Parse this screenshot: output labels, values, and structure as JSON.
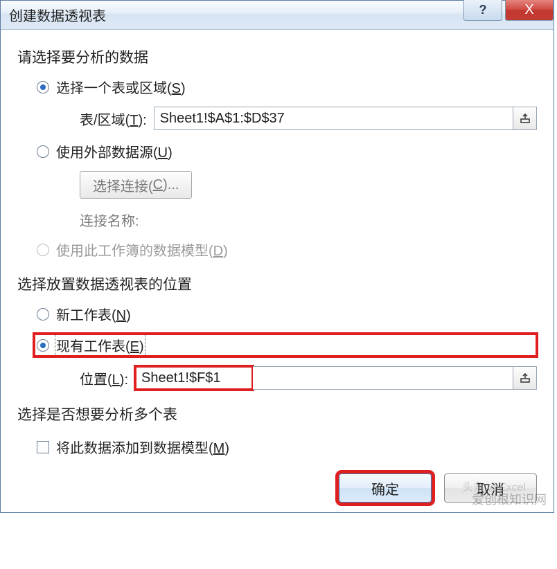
{
  "titlebar": {
    "title": "创建数据透视表",
    "help_symbol": "?",
    "close_symbol": "X"
  },
  "section_data": {
    "heading": "请选择要分析的数据",
    "opt_table": {
      "label_pre": "选择一个表或区域(",
      "accel": "S",
      "label_post": ")"
    },
    "range_label_pre": "表/区域(",
    "range_accel": "T",
    "range_label_post": "):",
    "range_value": "Sheet1!$A$1:$D$37",
    "opt_external": {
      "label_pre": "使用外部数据源(",
      "accel": "U",
      "label_post": ")"
    },
    "choose_conn_pre": "选择连接(",
    "choose_conn_accel": "C",
    "choose_conn_post": ")...",
    "conn_name_label": "连接名称:",
    "opt_model": {
      "label_pre": "使用此工作簿的数据模型(",
      "accel": "D",
      "label_post": ")"
    }
  },
  "section_place": {
    "heading": "选择放置数据透视表的位置",
    "opt_new": {
      "label_pre": "新工作表(",
      "accel": "N",
      "label_post": ")"
    },
    "opt_existing": {
      "label_pre": "现有工作表(",
      "accel": "E",
      "label_post": ")"
    },
    "loc_label_pre": "位置(",
    "loc_accel": "L",
    "loc_label_post": "):",
    "loc_value": "Sheet1!$F$1"
  },
  "section_multi": {
    "heading": "选择是否想要分析多个表",
    "add_model_pre": "将此数据添加到数据模型(",
    "add_model_accel": "M",
    "add_model_post": ")"
  },
  "buttons": {
    "ok": "确定",
    "cancel": "取消"
  },
  "watermark": {
    "line1": "爱创根知识网",
    "line2": "头条 @Excel"
  }
}
